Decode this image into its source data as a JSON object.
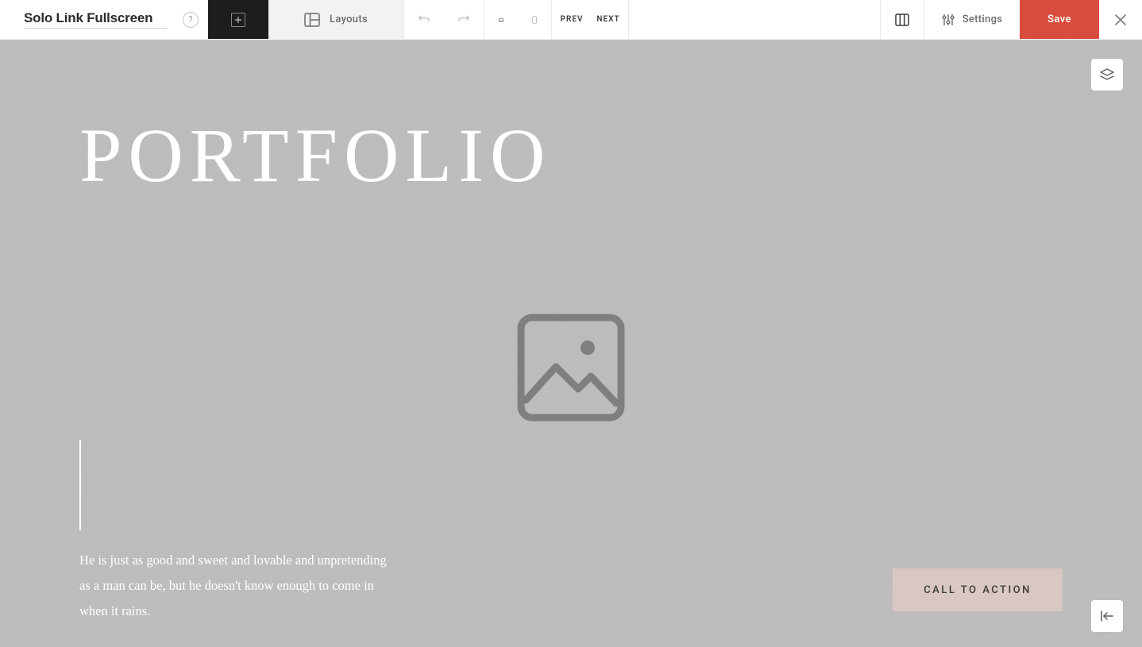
{
  "toolbar": {
    "title": "Solo Link Fullscreen",
    "layouts_label": "Layouts",
    "prev_label": "PREV",
    "next_label": "NEXT",
    "settings_label": "Settings",
    "save_label": "Save"
  },
  "hero": {
    "title": "PORTFOLIO",
    "body_text": "He is just as good and sweet and lovable and unpretending as a man can be, but he doesn't know enough to come in when it rains.",
    "cta_label": "CALL TO ACTION"
  },
  "colors": {
    "save_bg": "#d94c3d",
    "cta_bg": "#d8c7c3",
    "canvas_bg": "#bcbcbc"
  }
}
